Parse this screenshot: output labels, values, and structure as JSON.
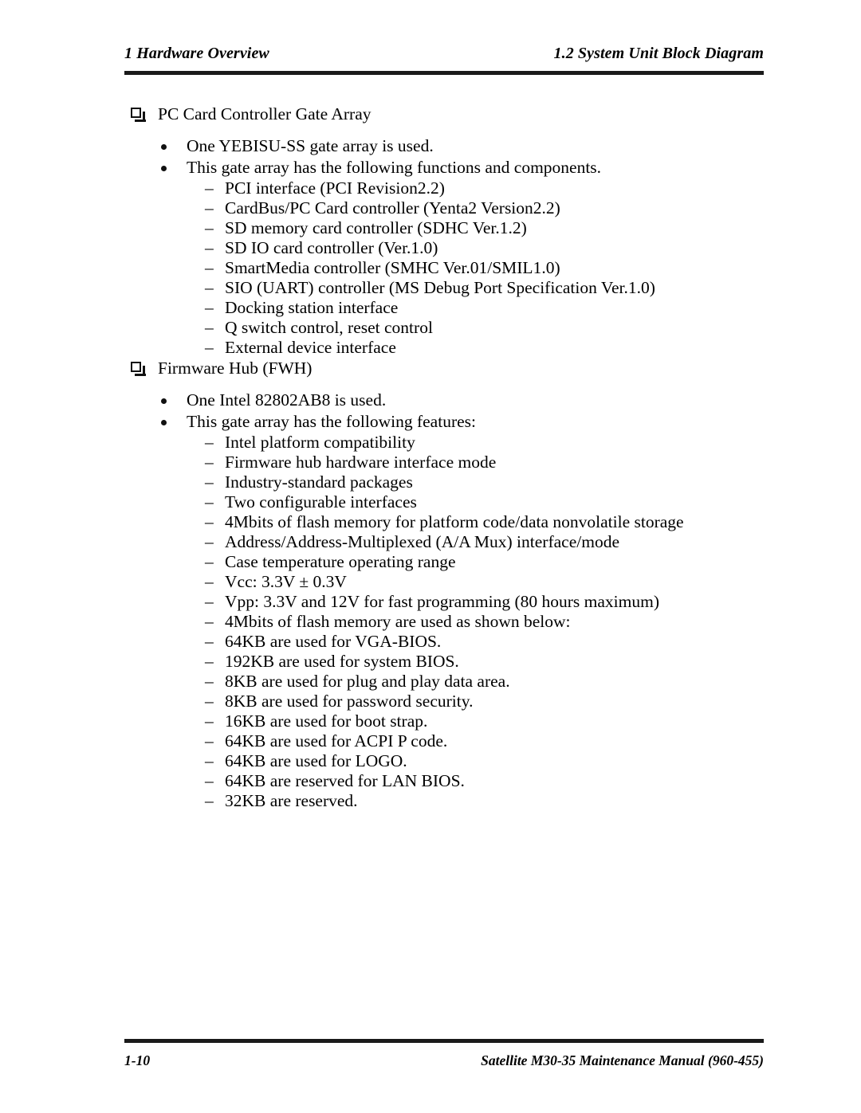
{
  "header": {
    "left": "1  Hardware Overview",
    "right": "1.2 System Unit Block Diagram"
  },
  "footer": {
    "page_number": "1-10",
    "manual_title": "Satellite M30-35 Maintenance Manual (960-455)"
  },
  "markers": {
    "level2_bullet": "bullet-dot",
    "level3_bullet": "en-dash",
    "level3_glyph": "–",
    "level1_glyph": "shadowed-white-square"
  },
  "sections": [
    {
      "heading": "PC Card Controller Gate Array",
      "bullets": [
        {
          "text": "One YEBISU-SS gate array is used.",
          "subitems": []
        },
        {
          "text": "This gate array has the following functions and components.",
          "subitems": [
            "PCI interface (PCI Revision2.2)",
            "CardBus/PC Card controller (Yenta2 Version2.2)",
            "SD memory card controller (SDHC Ver.1.2)",
            "SD IO card controller (Ver.1.0)",
            "SmartMedia controller (SMHC Ver.01/SMIL1.0)",
            "SIO (UART) controller (MS Debug Port Specification Ver.1.0)",
            "Docking station interface",
            "Q switch control, reset control",
            "External device interface"
          ]
        }
      ]
    },
    {
      "heading": "Firmware Hub (FWH)",
      "bullets": [
        {
          "text": "One Intel 82802AB8 is used.",
          "subitems": []
        },
        {
          "text": "This gate array has the following features:",
          "subitems": [
            "Intel platform compatibility",
            "Firmware hub hardware interface mode",
            "Industry-standard packages",
            "Two configurable interfaces",
            "4Mbits of flash memory for platform code/data nonvolatile storage",
            "Address/Address-Multiplexed (A/A Mux) interface/mode",
            "Case temperature operating range",
            "Vcc: 3.3V ± 0.3V",
            "Vpp: 3.3V and 12V for fast programming (80 hours maximum)",
            "4Mbits of flash memory are used as shown below:",
            "64KB are used for VGA-BIOS.",
            "192KB are used for system BIOS.",
            "8KB are used for plug and play data area.",
            "8KB are used for password security.",
            "16KB are used for boot strap.",
            "64KB are used for ACPI P code.",
            "64KB are used for LOGO.",
            "64KB are reserved for LAN BIOS.",
            "32KB are reserved."
          ]
        }
      ]
    }
  ]
}
